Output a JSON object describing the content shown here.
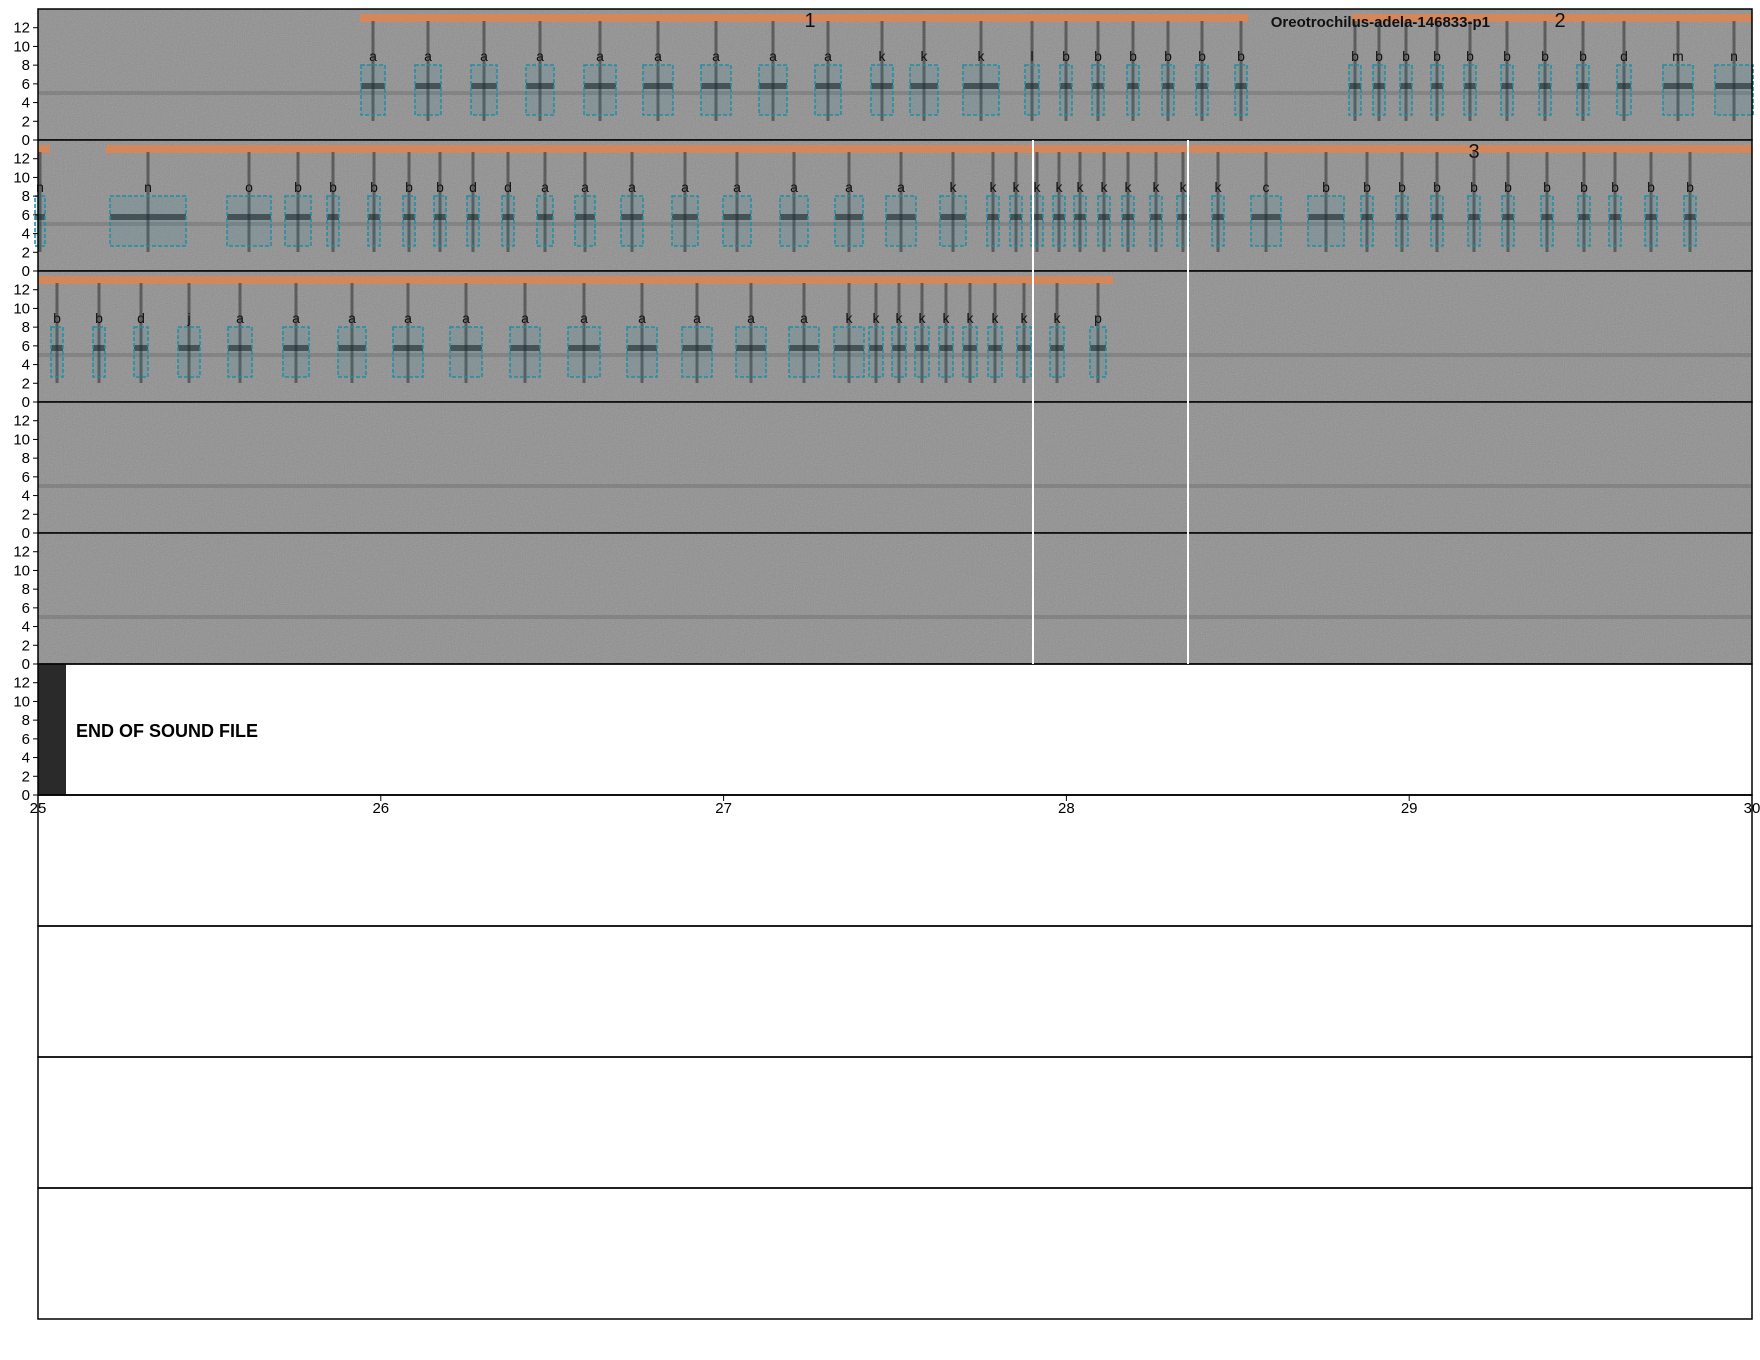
{
  "title": "Oreotrochilus-adela-146833-p1",
  "end_label": "END OF SOUND FILE",
  "y_ticks": [
    "0",
    "2",
    "4",
    "6",
    "8",
    "10",
    "12"
  ],
  "x_ticks": [
    "25",
    "26",
    "27",
    "28",
    "29",
    "30"
  ],
  "phrase_numbers": [
    "1",
    "2",
    "3"
  ],
  "colors": {
    "spectrogram_bg": "#8e8e8e",
    "phrase_bar": "#d4875a",
    "box": "#1f8ea3",
    "frame": "#000000"
  },
  "rows": [
    {
      "labels": [
        "a",
        "a",
        "a",
        "a",
        "a",
        "a",
        "a",
        "a",
        "a",
        "k",
        "k",
        "k",
        "l",
        "b",
        "b",
        "b",
        "b",
        "b",
        "b",
        "b",
        "b",
        "b",
        "b",
        "b",
        "b",
        "b",
        "b",
        "d",
        "m",
        "n"
      ]
    },
    {
      "labels": [
        "n",
        "n",
        "o",
        "b",
        "b",
        "b",
        "b",
        "b",
        "d",
        "d",
        "a",
        "a",
        "a",
        "a",
        "a",
        "a",
        "a",
        "a",
        "k",
        "k",
        "k",
        "k",
        "k",
        "k",
        "k",
        "k",
        "k",
        "k",
        "k",
        "c",
        "b",
        "b",
        "b",
        "b",
        "b",
        "b",
        "b",
        "b",
        "b",
        "b",
        "b"
      ]
    },
    {
      "labels": [
        "b",
        "b",
        "d",
        "j",
        "a",
        "a",
        "a",
        "a",
        "a",
        "a",
        "a",
        "a",
        "a",
        "a",
        "a",
        "k",
        "k",
        "k",
        "k",
        "k",
        "k",
        "k",
        "k",
        "k",
        "p"
      ]
    },
    {
      "labels": []
    },
    {
      "labels": []
    },
    {
      "labels": []
    }
  ]
}
